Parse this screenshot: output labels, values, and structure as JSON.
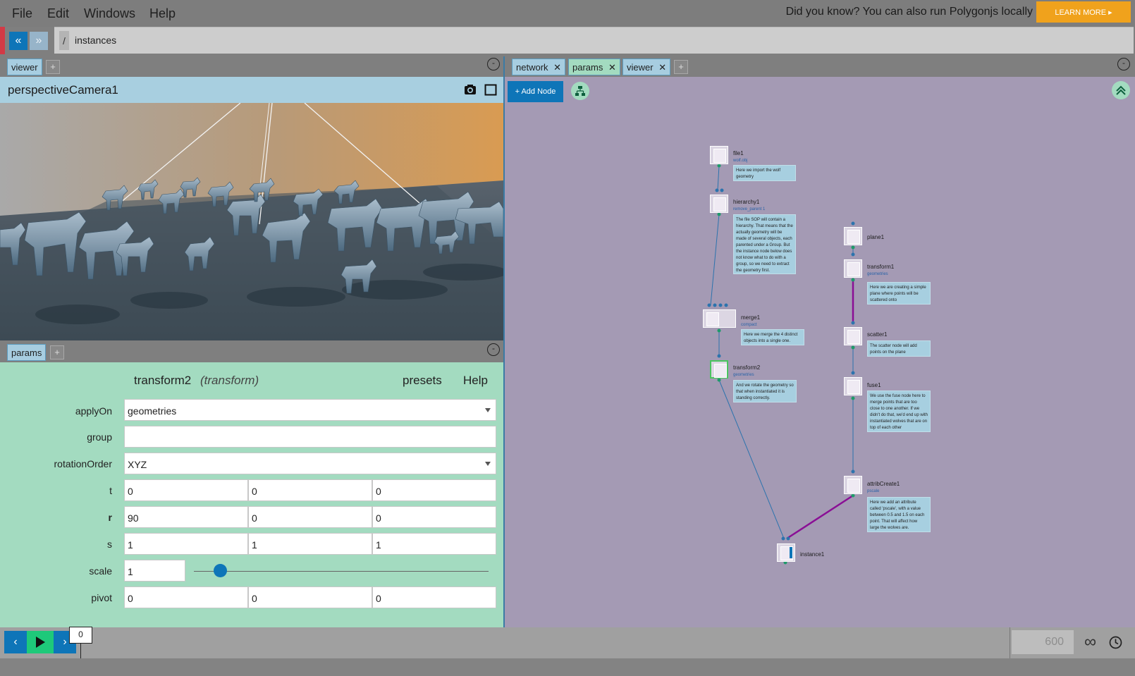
{
  "menu": [
    "File",
    "Edit",
    "Windows",
    "Help"
  ],
  "promo": {
    "text": "Did you know? You can also run Polygonjs locally",
    "button": "LEARN MORE ▸"
  },
  "path": {
    "root": "/",
    "current": "instances"
  },
  "viewer_panel": {
    "tab": "viewer",
    "camera": "perspectiveCamera1"
  },
  "params_panel": {
    "tab": "params",
    "node_name": "transform2",
    "node_type": "(transform)",
    "presets": "presets",
    "help": "Help",
    "fields": {
      "applyOn": {
        "label": "applyOn",
        "value": "geometries"
      },
      "group": {
        "label": "group",
        "value": ""
      },
      "rotationOrder": {
        "label": "rotationOrder",
        "value": "XYZ"
      },
      "t": {
        "label": "t",
        "values": [
          "0",
          "0",
          "0"
        ]
      },
      "r": {
        "label": "r",
        "values": [
          "90",
          "0",
          "0"
        ]
      },
      "s": {
        "label": "s",
        "values": [
          "1",
          "1",
          "1"
        ]
      },
      "scale": {
        "label": "scale",
        "value": "1",
        "slider_fraction": 0.09
      },
      "pivot": {
        "label": "pivot",
        "values": [
          "0",
          "0",
          "0"
        ]
      }
    }
  },
  "network_panel": {
    "tabs": [
      "network",
      "params",
      "viewer"
    ],
    "add_node": "+ Add Node",
    "nodes": {
      "file1": {
        "name": "file1",
        "sub": "wolf.obj",
        "note": "Here we import the wolf geometry"
      },
      "hierarchy1": {
        "name": "hierarchy1",
        "sub": "remove_parent 1",
        "note": "The file SOP will contain a hierarchy. That means that the actually geometry will be made of several objects, each parented under a Group. But the instance node below does not know what to do with a group, so we need to extract the geometry first."
      },
      "merge1": {
        "name": "merge1",
        "sub": "compact",
        "note": "Here we merge the 4 distinct objects into a single one."
      },
      "transform2": {
        "name": "transform2",
        "sub": "geometries",
        "note": "And we rotate the geometry so that when instantiated it is standing correctly."
      },
      "plane1": {
        "name": "plane1"
      },
      "transform1": {
        "name": "transform1",
        "sub": "geometries",
        "note": "Here we are creating a simple plane where points will be scattered onto"
      },
      "scatter1": {
        "name": "scatter1",
        "note": "The scatter node will add points on the plane"
      },
      "fuse1": {
        "name": "fuse1",
        "note": "We use the fuse node here to merge points that are too close to one another. If we didn't do that, we'd end up with instantiated wolves that are on top of each other"
      },
      "attribCreate1": {
        "name": "attribCreate1",
        "sub": "pscale",
        "note": "Here we add an attribute called 'pscale', with a value between 0.5 and 1.5 on each point. That will affect how large the wolves are."
      },
      "instance1": {
        "name": "instance1"
      }
    }
  },
  "timeline": {
    "frame": "0",
    "end": "600"
  },
  "colors": {
    "accent": "#0e75b8",
    "play": "#1ec97a",
    "promo": "#f0a21c",
    "params_bg": "#a3dbc0",
    "network_bg": "#a49ab4"
  }
}
